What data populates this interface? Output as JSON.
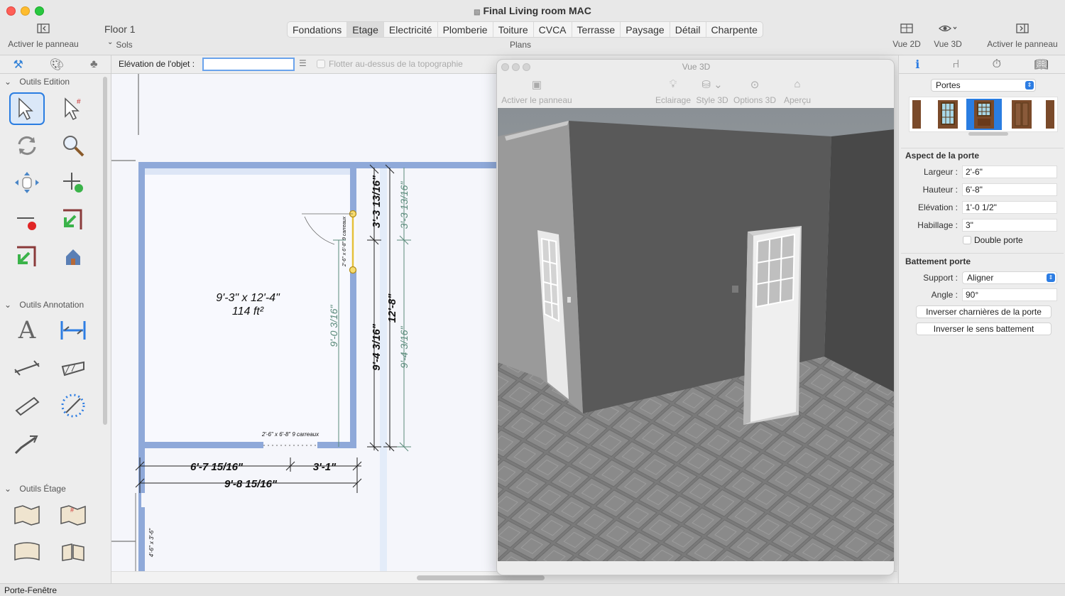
{
  "window": {
    "title": "Final Living room MAC"
  },
  "toolbar": {
    "left_panel_label": "Activer le panneau",
    "floor_value": "Floor 1",
    "floor_label": "Sols",
    "plans_tabs": [
      "Fondations",
      "Etage",
      "Electricité",
      "Plomberie",
      "Toiture",
      "CVCA",
      "Terrasse",
      "Paysage",
      "Détail",
      "Charpente"
    ],
    "plans_active": "Etage",
    "plans_label": "Plans",
    "view2d_label": "Vue 2D",
    "view3d_label": "Vue 3D",
    "right_panel_label": "Activer le panneau"
  },
  "left_panel": {
    "sections": [
      "Outils Edition",
      "Outils Annotation",
      "Outils Étage"
    ]
  },
  "object_toolbar": {
    "elevation_label": "Elévation de l'objet :",
    "elevation_value": "",
    "float_label": "Flotter au-dessus de la topographie"
  },
  "plan": {
    "room_dims": "9'-3\" x 12'-4\"",
    "room_area": "114 ft²",
    "dims": {
      "d1": "3'-3 13/16\"",
      "d2": "3'-3 13/16\"",
      "d3": "9'-0 3/16\"",
      "d4": "9'-4 3/16\"",
      "d5": "12'-8\"",
      "d6": "9'-4 3/16\"",
      "d7": "6'-7 15/16\"",
      "d8": "3'-1\"",
      "d9": "9'-8 15/16\"",
      "door_v": "2'-6\" x 6'-8\" 9 carreaux",
      "door_h": "2'-6\" x 6'-8\" 9 carreaux",
      "bottom_v": "4'-6\" x 3'-6\""
    }
  },
  "view3d": {
    "title": "Vue 3D",
    "panel_label": "Activer le panneau",
    "buttons": [
      "Eclairage",
      "Style 3D",
      "Options 3D",
      "Aperçu"
    ]
  },
  "right_panel": {
    "category": "Portes",
    "aspect_heading": "Aspect de la porte",
    "fields": [
      {
        "label": "Largeur :",
        "value": "2'-6\""
      },
      {
        "label": "Hauteur :",
        "value": "6'-8\""
      },
      {
        "label": "Elévation :",
        "value": "1'-0 1/2\""
      },
      {
        "label": "Habillage :",
        "value": "3\""
      }
    ],
    "double_door_label": "Double porte",
    "swing_heading": "Battement porte",
    "support_label": "Support :",
    "support_value": "Aligner",
    "angle_label": "Angle :",
    "angle_value": "90°",
    "btn_hinges": "Inverser charnières de la porte",
    "btn_swing": "Inverser le sens battement"
  },
  "status": {
    "text": "Porte-Fenêtre"
  },
  "colors": {
    "wall": "#8fa9d9",
    "accent": "#2a7de1",
    "dim_green": "#5a8a7a"
  }
}
